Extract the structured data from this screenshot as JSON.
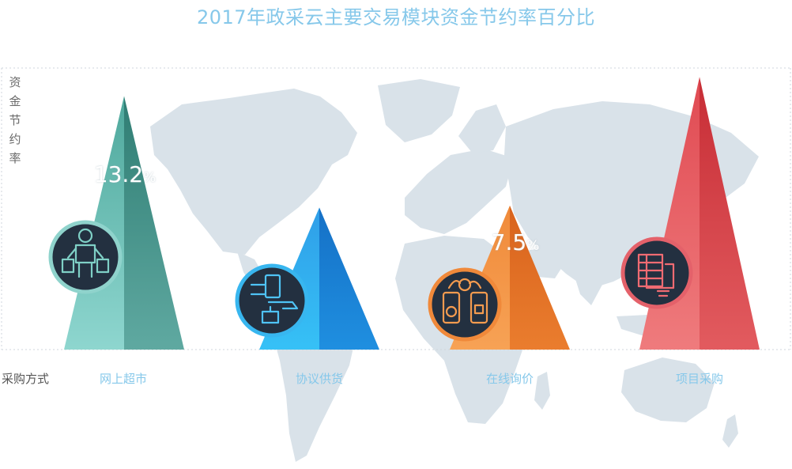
{
  "chart_data": {
    "type": "bar",
    "title": "2017年政采云主要交易模块资金节约率百分比",
    "xlabel": "采购方式",
    "ylabel": "资金节约率",
    "categories": [
      "网上超市",
      "协议供货",
      "在线询价",
      "项目采购"
    ],
    "values": [
      13.2,
      7.4,
      7.5,
      14.2
    ],
    "value_labels": [
      {
        "num": "13.2",
        "unit": "%"
      },
      {
        "num": "",
        "unit": ""
      },
      {
        "num": "7.5",
        "unit": "%"
      },
      {
        "num": "",
        "unit": ""
      }
    ],
    "ylim": [
      0,
      14.5
    ],
    "colors": [
      "#5fb8ae",
      "#2a95e0",
      "#ee8a3e",
      "#e2585c"
    ],
    "icons": [
      "shopper-with-bags-icon",
      "card-payment-handshake-icon",
      "phone-dollar-exchange-icon",
      "project-documents-icon"
    ]
  }
}
